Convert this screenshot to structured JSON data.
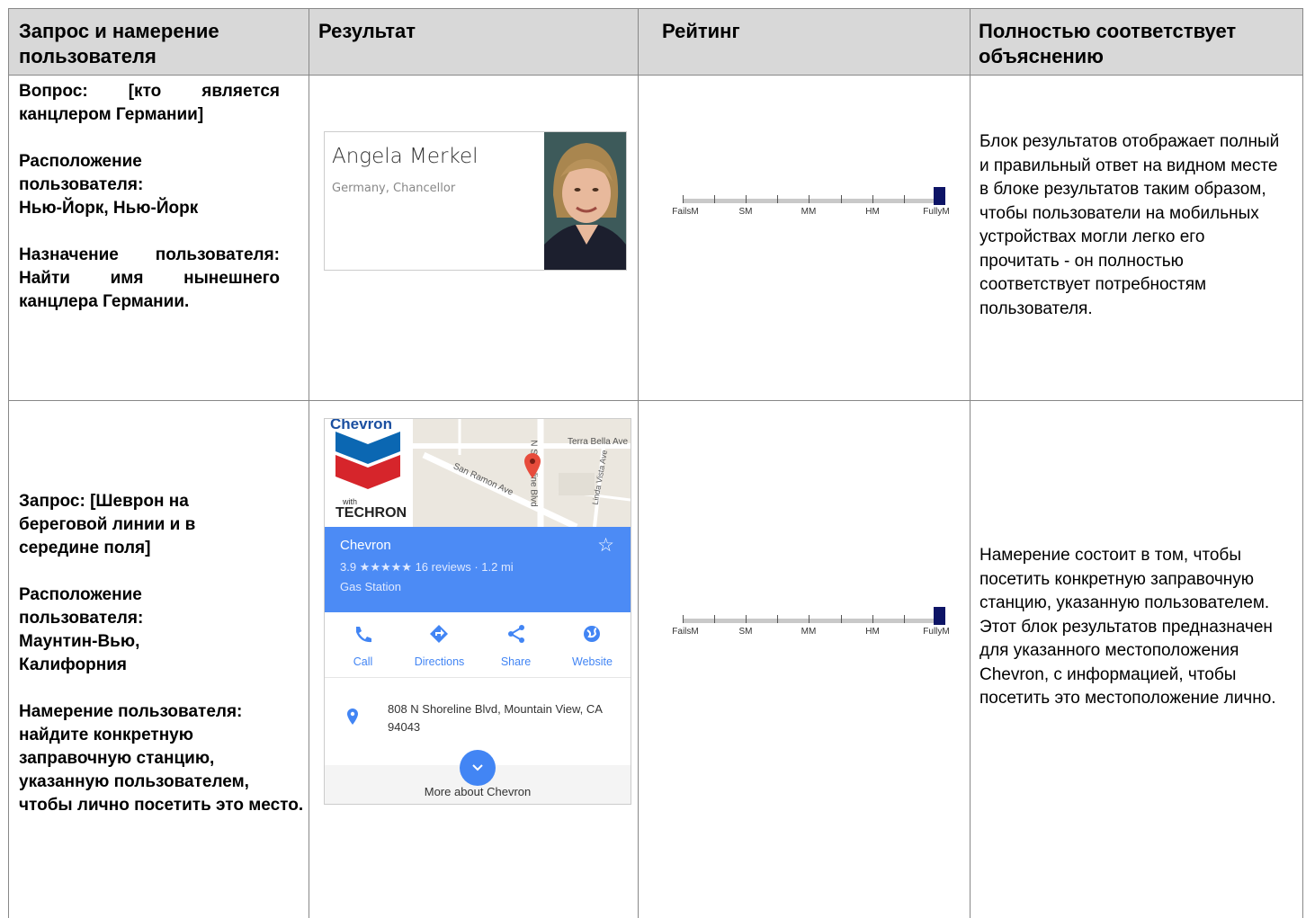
{
  "header": {
    "col1": "Запрос и намерение пользователя",
    "col2": "Результат",
    "col3": "Рейтинг",
    "col4": "Полностью соответствует объяснению"
  },
  "row1": {
    "q_line1": "Вопрос: [кто является канцлером Германии]",
    "loc_label": "Расположение пользователя:",
    "loc_value": "Нью-Йорк, Нью-Йорк",
    "intent": "Назначение пользователя: Найти имя нынешнего канцлера Германии.",
    "result_name": "Angela Merkel",
    "result_sub": "Germany, Chancellor",
    "explanation": "Блок результатов отображает полный и правильный ответ на видном месте в блоке результатов таким образом, чтобы пользователи на мобильных устройствах могли легко его прочитать - он полностью соответствует потребностям пользователя.",
    "rating_level": "FullyM"
  },
  "row2": {
    "query": "Запрос: [Шеврон на береговой линии и в середине поля]",
    "loc_label": "Расположение пользователя:",
    "loc_value": "Маунтин-Вью, Калифорния",
    "intent": "Намерение пользователя: найдите конкретную заправочную станцию, указанную пользователем, чтобы лично посетить это место.",
    "explanation": "Намерение состоит в том, чтобы посетить конкретную заправочную станцию, указанную пользователем. Этот блок результатов предназначен для указанного местоположения Chevron, с информацией, чтобы посетить это местоположение лично.",
    "rating_level": "FullyM",
    "card": {
      "map_labels": [
        "Terra Bella Ave",
        "San Ramon Ave",
        "N Shoreline Blvd",
        "Linda Vista Ave"
      ],
      "logo_top": "Chevron",
      "logo_with": "with",
      "logo_brand": "TECHRON",
      "title": "Chevron",
      "rating_text": "3.9 ★★★★★ 16 reviews · 1.2 mi",
      "category": "Gas Station",
      "actions": [
        "Call",
        "Directions",
        "Share",
        "Website"
      ],
      "address": "808 N Shoreline Blvd, Mountain View, CA 94043",
      "more": "More about Chevron"
    }
  },
  "scale_labels": [
    "FailsM",
    "SM",
    "MM",
    "HM",
    "FullyM"
  ],
  "colors": {
    "header_bg": "#d8d8d8",
    "rating_fill": "#0d1466",
    "card_blue": "#4c8bf5",
    "action_blue": "#4285f4"
  }
}
